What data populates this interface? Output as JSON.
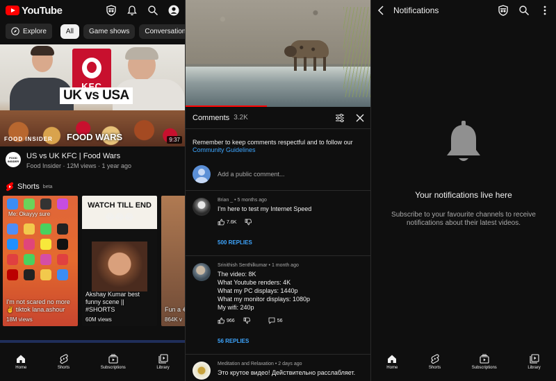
{
  "home": {
    "logo_text": "YouTube",
    "chips": [
      {
        "label": "Explore"
      },
      {
        "label": "All"
      },
      {
        "label": "Game shows"
      },
      {
        "label": "Conversation"
      }
    ],
    "video": {
      "thumb_text": "UK vs USA",
      "thumb_brand": "KFC",
      "thumb_show": "FOOD WARS",
      "thumb_channel_logo": "FOOD INSIDER",
      "duration": "9:37",
      "title": "US vs UK KFC | Food Wars",
      "meta": "Food Insider · 12M views · 1 year ago",
      "channel_avatar_text": "FOOD INSIDER"
    },
    "shorts": {
      "title": "Shorts",
      "badge": "beta",
      "items": [
        {
          "title": "I'm not scared no more ✌️ tiktok lana.ashour",
          "views": "18M views",
          "overlay": "Me: Okayyy sure"
        },
        {
          "title": "Akshay Kumar best funny scene || #SHORTS",
          "views": "60M views",
          "overlay": "WATCH TILL END"
        },
        {
          "title": "Fun a 😂😢",
          "views": "864K v",
          "overlay": ""
        }
      ]
    },
    "nav": [
      {
        "label": "Home"
      },
      {
        "label": "Shorts"
      },
      {
        "label": "Subscriptions"
      },
      {
        "label": "Library"
      }
    ]
  },
  "comments": {
    "header": "Comments",
    "count": "3.2K",
    "guideline_text": "Remember to keep comments respectful and to follow our",
    "guideline_link": "Community Guidelines",
    "placeholder": "Add a public comment...",
    "items": [
      {
        "author": "Brian _",
        "time": "5 months ago",
        "text": "I'm here to test my Internet Speed",
        "likes": "7.6K",
        "replies_count": "",
        "replies_label": "500 REPLIES"
      },
      {
        "author": "Srinithish Senthilkumar",
        "time": "1 month ago",
        "text": "The video: 8K\nWhat Youtube renders: 4K\nWhat my PC displays: 1440p\nWhat my monitor displays: 1080p\nMy wifi: 240p",
        "likes": "966",
        "replies_count": "56",
        "replies_label": "56 REPLIES"
      },
      {
        "author": "Meditation and Relaxation",
        "time": "2 days ago",
        "text": "Это крутое видео! Действительно расслабляет.",
        "likes": "",
        "replies_count": "",
        "replies_label": ""
      }
    ]
  },
  "notifications": {
    "title": "Notifications",
    "empty_title": "Your notifications live here",
    "empty_sub": "Subscribe to your favourite channels to receive notifications about their latest videos.",
    "nav": [
      {
        "label": "Home"
      },
      {
        "label": "Shorts"
      },
      {
        "label": "Subscriptions"
      },
      {
        "label": "Library"
      }
    ]
  },
  "colors": {
    "background": "#0f0f0f",
    "accent_red": "#ff0000",
    "link_blue": "#3ea6ff",
    "secondary_text": "#aaaaaa"
  }
}
